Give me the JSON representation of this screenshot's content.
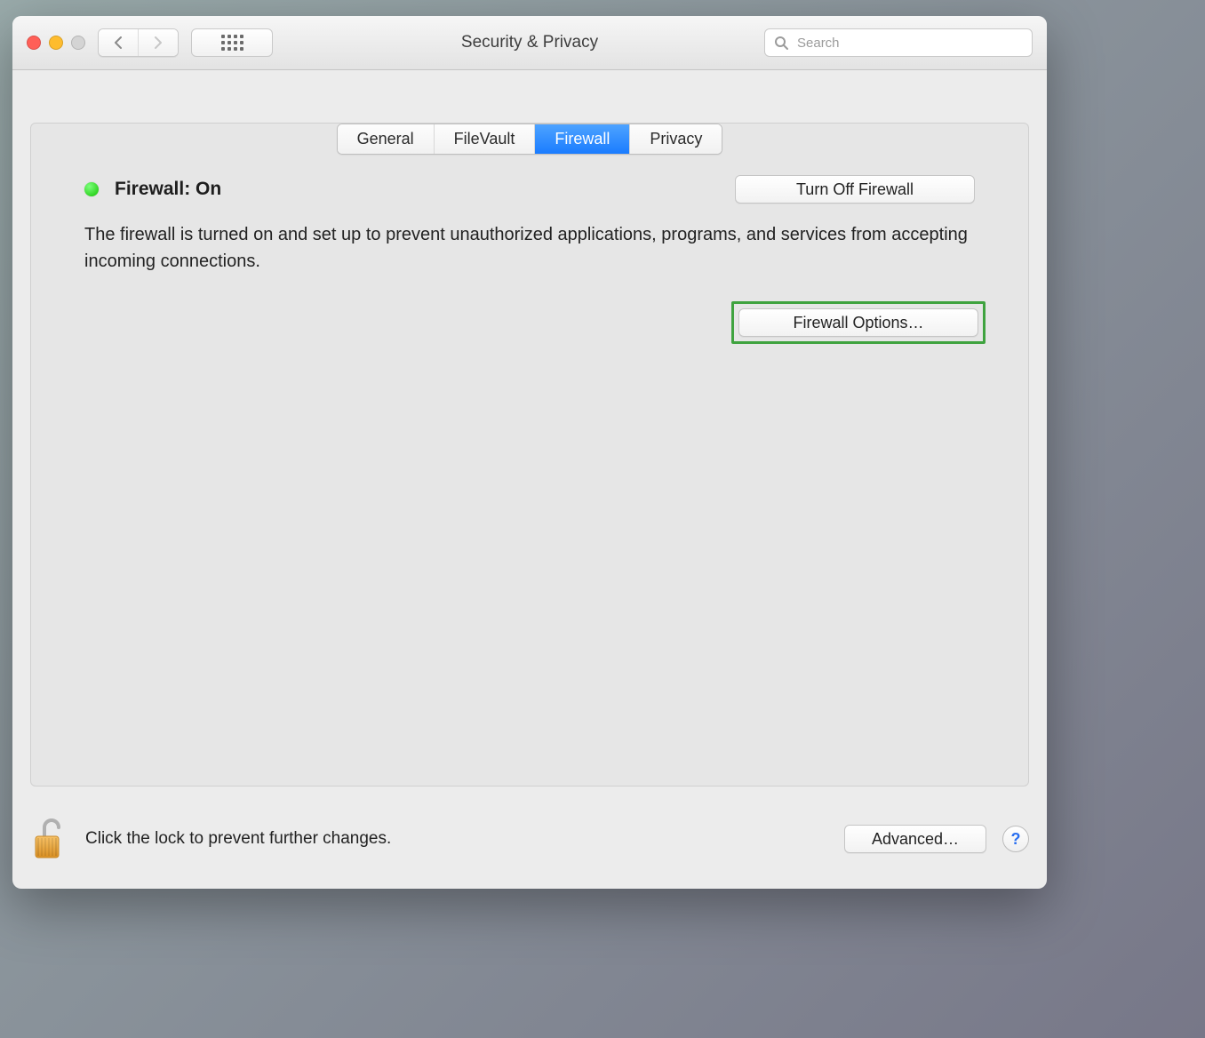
{
  "window": {
    "title": "Security & Privacy"
  },
  "search": {
    "placeholder": "Search",
    "value": ""
  },
  "tabs": [
    {
      "label": "General",
      "active": false
    },
    {
      "label": "FileVault",
      "active": false
    },
    {
      "label": "Firewall",
      "active": true
    },
    {
      "label": "Privacy",
      "active": false
    }
  ],
  "firewall": {
    "status_label": "Firewall: On",
    "status_color": "#13c400",
    "toggle_button": "Turn Off Firewall",
    "description": "The firewall is turned on and set up to prevent unauthorized applications, programs, and services from accepting incoming connections.",
    "options_button": "Firewall Options…"
  },
  "footer": {
    "lock_text": "Click the lock to prevent further changes.",
    "advanced_button": "Advanced…",
    "help_label": "?"
  },
  "colors": {
    "accent": "#1a7cff",
    "highlight_border": "#3fa33f"
  }
}
